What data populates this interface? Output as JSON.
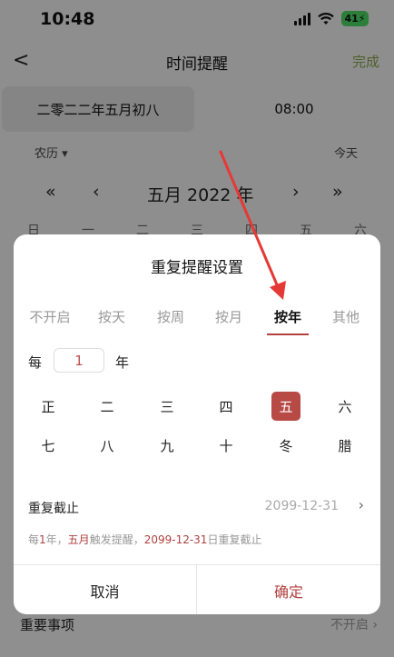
{
  "status_bar": {
    "time": "10:48",
    "battery": "41"
  },
  "nav": {
    "back": "<",
    "title": "时间提醒",
    "done": "完成"
  },
  "date_tabs": {
    "lunar_date": "二零二二年五月初八",
    "time": "08:00"
  },
  "calendar": {
    "mode": "农历 ▾",
    "today": "今天",
    "prev_year": "«",
    "prev_month": "‹",
    "title": "五月 2022 年",
    "next_month": "›",
    "next_year": "»",
    "weekdays": [
      "日",
      "一",
      "二",
      "三",
      "四",
      "五",
      "六"
    ]
  },
  "background_row": {
    "label": "重要事项",
    "value": "不开启 ›"
  },
  "modal": {
    "title": "重复提醒设置",
    "tabs": [
      "不开启",
      "按天",
      "按周",
      "按月",
      "按年",
      "其他"
    ],
    "active_tab_index": 4,
    "every_label": "每",
    "every_value": "1",
    "every_unit": "年",
    "months": [
      "正",
      "二",
      "三",
      "四",
      "五",
      "六",
      "七",
      "八",
      "九",
      "十",
      "冬",
      "腊"
    ],
    "selected_month_index": 4,
    "end_label": "重复截止",
    "end_value": "2099-12-31",
    "end_chevron": "›",
    "summary": {
      "p1": "每",
      "n1": "1",
      "p2": "年，",
      "month": "五月",
      "p3": "触发提醒，",
      "date": "2099-12-31",
      "p4": "日重复截止"
    },
    "cancel": "取消",
    "confirm": "确定"
  },
  "colors": {
    "accent": "#b0413e",
    "done_green": "#8aa64c",
    "annotation_arrow": "#e53935"
  }
}
